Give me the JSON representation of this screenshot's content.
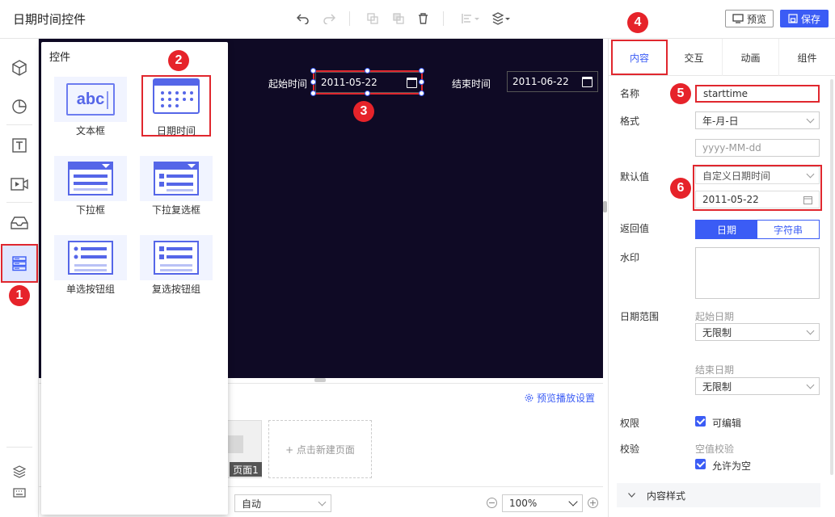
{
  "app": {
    "title": "日期时间控件"
  },
  "toolbar": {
    "preview_label": "预览",
    "save_label": "保存",
    "icons": [
      "undo-icon",
      "redo-icon",
      "copy-icon",
      "paste-icon",
      "delete-icon",
      "align-icon",
      "layers-icon"
    ]
  },
  "markers": [
    "1",
    "2",
    "3",
    "4",
    "5",
    "6"
  ],
  "canvas": {
    "start_label": "起始时间",
    "start_value": "2011-05-22",
    "end_label": "结束时间",
    "end_value": "2011-06-22"
  },
  "controls_popup": {
    "title": "控件",
    "items": [
      {
        "label": "文本框",
        "icon": "textbox-icon",
        "glyph": "abc"
      },
      {
        "label": "日期时间",
        "icon": "calendar-icon"
      },
      {
        "label": "下拉框",
        "icon": "dropdown-icon"
      },
      {
        "label": "下拉复选框",
        "icon": "dropdown-checkbox-icon"
      },
      {
        "label": "单选按钮组",
        "icon": "radio-group-icon"
      },
      {
        "label": "复选按钮组",
        "icon": "checkbox-group-icon"
      }
    ]
  },
  "pages": {
    "preview_settings": "预览播放设置",
    "page_label": "页面1",
    "new_page": "+ 点击新建页面"
  },
  "bottom": {
    "auto_value": "自动",
    "zoom_value": "100%"
  },
  "right_panel": {
    "tabs": [
      "内容",
      "交互",
      "动画",
      "组件"
    ],
    "name_label": "名称",
    "name_value": "starttime",
    "format_label": "格式",
    "format_value": "年-月-日",
    "format_placeholder": "yyyy-MM-dd",
    "default_label": "默认值",
    "default_mode": "自定义日期时间",
    "default_value": "2011-05-22",
    "return_label": "返回值",
    "return_options": [
      "日期",
      "字符串"
    ],
    "watermark_label": "水印",
    "range_label": "日期范围",
    "range_start_label": "起始日期",
    "range_start_value": "无限制",
    "range_end_label": "结束日期",
    "range_end_value": "无限制",
    "permission_label": "权限",
    "permission_option": "可编辑",
    "validation_label": "校验",
    "validation_sub": "空值校验",
    "validation_option": "允许为空",
    "style_section": "内容样式"
  },
  "colors": {
    "accent": "#3b5cf5",
    "highlight": "#e0272e",
    "canvas_bg": "#0f0a25"
  }
}
